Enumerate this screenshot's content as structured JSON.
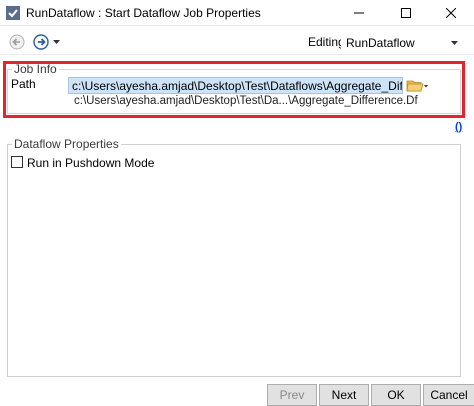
{
  "window": {
    "title": "RunDataflow : Start Dataflow Job Properties"
  },
  "toolbar": {
    "editing_label": "Editing:",
    "editing_value": "RunDataflow"
  },
  "job_info": {
    "legend": "Job Info",
    "path_label": "Path",
    "path_value": "c:\\Users\\ayesha.amjad\\Desktop\\Test\\Dataflows\\Aggregate_Difference.Df",
    "path_short": "c:\\Users\\ayesha.amjad\\Desktop\\Test\\Da...\\Aggregate_Difference.Df"
  },
  "help_link": "()",
  "dataflow_props": {
    "legend": "Dataflow Properties",
    "pushdown_label": "Run in Pushdown Mode",
    "pushdown_checked": false
  },
  "footer": {
    "prev": "Prev",
    "next": "Next",
    "ok": "OK",
    "cancel": "Cancel"
  },
  "colors": {
    "highlight": "#e3262e",
    "path_bg": "#cfe3f6"
  }
}
